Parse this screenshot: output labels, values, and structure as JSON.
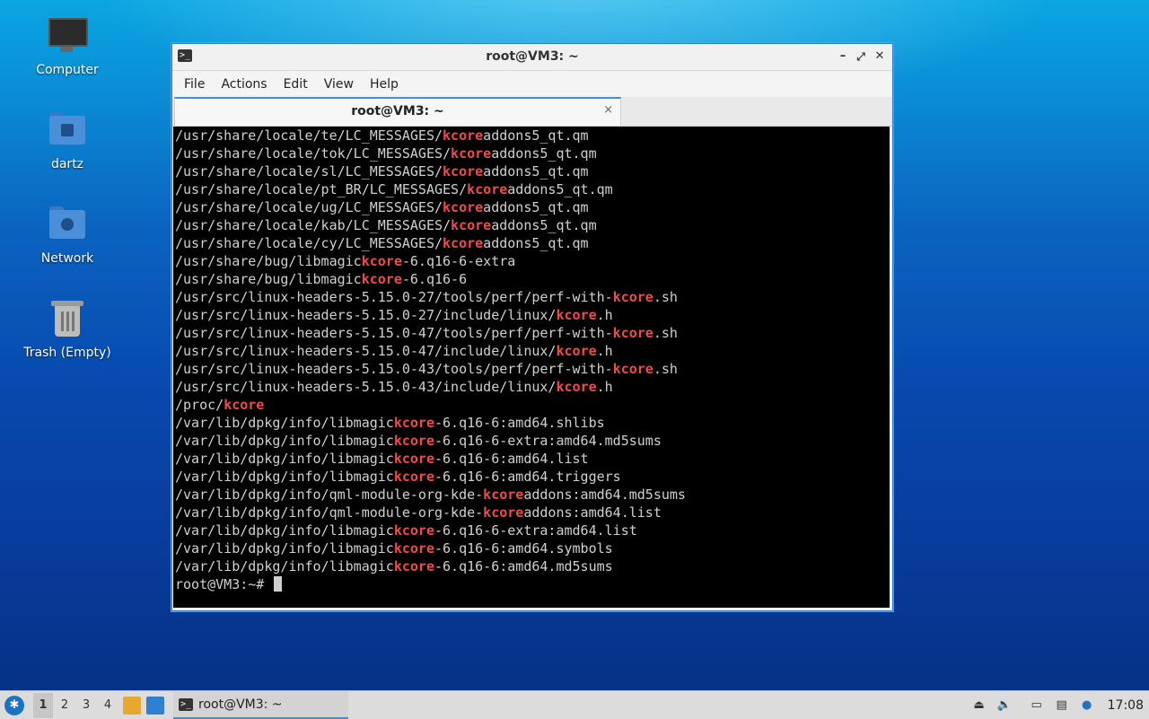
{
  "desktop": {
    "icons": [
      {
        "label": "Computer",
        "icon": "computer-icon"
      },
      {
        "label": "dartz",
        "icon": "home-folder-icon"
      },
      {
        "label": "Network",
        "icon": "network-folder-icon"
      },
      {
        "label": "Trash (Empty)",
        "icon": "trash-icon"
      }
    ]
  },
  "window": {
    "title": "root@VM3: ~",
    "buttons": {
      "minimize": "–",
      "maximize": "⤢",
      "close": "✕"
    },
    "menu": [
      "File",
      "Actions",
      "Edit",
      "View",
      "Help"
    ],
    "tab": {
      "title": "root@VM3: ~",
      "close": "×"
    }
  },
  "terminal": {
    "lines": [
      {
        "pre": "/usr/share/locale/te/LC_MESSAGES/",
        "hl": "kcore",
        "post": "addons5_qt.qm"
      },
      {
        "pre": "/usr/share/locale/tok/LC_MESSAGES/",
        "hl": "kcore",
        "post": "addons5_qt.qm"
      },
      {
        "pre": "/usr/share/locale/sl/LC_MESSAGES/",
        "hl": "kcore",
        "post": "addons5_qt.qm"
      },
      {
        "pre": "/usr/share/locale/pt_BR/LC_MESSAGES/",
        "hl": "kcore",
        "post": "addons5_qt.qm"
      },
      {
        "pre": "/usr/share/locale/ug/LC_MESSAGES/",
        "hl": "kcore",
        "post": "addons5_qt.qm"
      },
      {
        "pre": "/usr/share/locale/kab/LC_MESSAGES/",
        "hl": "kcore",
        "post": "addons5_qt.qm"
      },
      {
        "pre": "/usr/share/locale/cy/LC_MESSAGES/",
        "hl": "kcore",
        "post": "addons5_qt.qm"
      },
      {
        "pre": "/usr/share/bug/libmagic",
        "hl": "kcore",
        "post": "-6.q16-6-extra"
      },
      {
        "pre": "/usr/share/bug/libmagic",
        "hl": "kcore",
        "post": "-6.q16-6"
      },
      {
        "pre": "/usr/src/linux-headers-5.15.0-27/tools/perf/perf-with-",
        "hl": "kcore",
        "post": ".sh"
      },
      {
        "pre": "/usr/src/linux-headers-5.15.0-27/include/linux/",
        "hl": "kcore",
        "post": ".h"
      },
      {
        "pre": "/usr/src/linux-headers-5.15.0-47/tools/perf/perf-with-",
        "hl": "kcore",
        "post": ".sh"
      },
      {
        "pre": "/usr/src/linux-headers-5.15.0-47/include/linux/",
        "hl": "kcore",
        "post": ".h"
      },
      {
        "pre": "/usr/src/linux-headers-5.15.0-43/tools/perf/perf-with-",
        "hl": "kcore",
        "post": ".sh"
      },
      {
        "pre": "/usr/src/linux-headers-5.15.0-43/include/linux/",
        "hl": "kcore",
        "post": ".h"
      },
      {
        "pre": "/proc/",
        "hl": "kcore",
        "post": ""
      },
      {
        "pre": "/var/lib/dpkg/info/libmagic",
        "hl": "kcore",
        "post": "-6.q16-6:amd64.shlibs"
      },
      {
        "pre": "/var/lib/dpkg/info/libmagic",
        "hl": "kcore",
        "post": "-6.q16-6-extra:amd64.md5sums"
      },
      {
        "pre": "/var/lib/dpkg/info/libmagic",
        "hl": "kcore",
        "post": "-6.q16-6:amd64.list"
      },
      {
        "pre": "/var/lib/dpkg/info/libmagic",
        "hl": "kcore",
        "post": "-6.q16-6:amd64.triggers"
      },
      {
        "pre": "/var/lib/dpkg/info/qml-module-org-kde-",
        "hl": "kcore",
        "post": "addons:amd64.md5sums"
      },
      {
        "pre": "/var/lib/dpkg/info/qml-module-org-kde-",
        "hl": "kcore",
        "post": "addons:amd64.list"
      },
      {
        "pre": "/var/lib/dpkg/info/libmagic",
        "hl": "kcore",
        "post": "-6.q16-6-extra:amd64.list"
      },
      {
        "pre": "/var/lib/dpkg/info/libmagic",
        "hl": "kcore",
        "post": "-6.q16-6:amd64.symbols"
      },
      {
        "pre": "/var/lib/dpkg/info/libmagic",
        "hl": "kcore",
        "post": "-6.q16-6:amd64.md5sums"
      }
    ],
    "prompt": "root@VM3:~# ",
    "highlight_color": "#ef4b4b"
  },
  "taskbar": {
    "workspaces": [
      "1",
      "2",
      "3",
      "4"
    ],
    "active_workspace": "1",
    "task_title": "root@VM3: ~",
    "tray_icons": [
      "eject-icon",
      "volume-icon",
      "network-icon",
      "clipboard-icon",
      "updates-icon"
    ],
    "clock": "17:08"
  }
}
